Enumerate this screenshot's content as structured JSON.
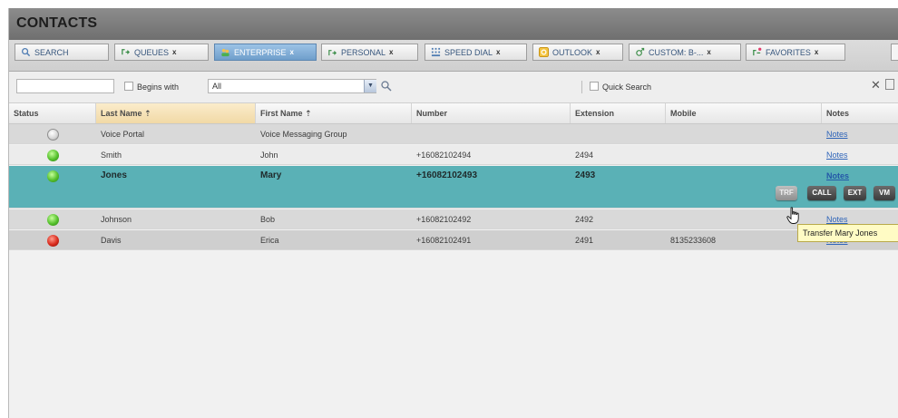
{
  "app": {
    "title": "CONTACTS"
  },
  "tabs": [
    {
      "label": "SEARCH",
      "close": "",
      "icon": "search-icon"
    },
    {
      "label": "QUEUES",
      "close": "x",
      "icon": "queues-icon"
    },
    {
      "label": "ENTERPRISE",
      "close": "x",
      "icon": "enterprise-icon",
      "active": true
    },
    {
      "label": "PERSONAL",
      "close": "x",
      "icon": "personal-icon"
    },
    {
      "label": "SPEED DIAL",
      "close": "x",
      "icon": "speed-dial-icon"
    },
    {
      "label": "OUTLOOK",
      "close": "x",
      "icon": "outlook-icon"
    },
    {
      "label": "CUSTOM: B-...",
      "close": "x",
      "icon": "custom-icon"
    },
    {
      "label": "FAVORITES",
      "close": "x",
      "icon": "favorites-icon"
    }
  ],
  "search": {
    "value": "",
    "begins_with_label": "Begins with",
    "filter_value": "All",
    "quick_search_label": "Quick Search",
    "close_label": "✕"
  },
  "columns": {
    "status": "Status",
    "last_name": "Last Name",
    "first_name": "First Name",
    "number": "Number",
    "extension": "Extension",
    "mobile": "Mobile",
    "notes": "Notes",
    "sort_indicator": "⇡"
  },
  "rows": [
    {
      "status": "gray",
      "last_name": "Voice Portal",
      "first_name": "Voice Messaging Group",
      "number": "",
      "extension": "",
      "mobile": "",
      "notes": "Notes"
    },
    {
      "status": "green",
      "last_name": "Smith",
      "first_name": "John",
      "number": "+16082102494",
      "extension": "2494",
      "mobile": "",
      "notes": "Notes"
    },
    {
      "status": "green",
      "last_name": "Jones",
      "first_name": "Mary",
      "number": "+16082102493",
      "extension": "2493",
      "mobile": "",
      "notes": "Notes",
      "selected": true
    },
    {
      "status": "green",
      "last_name": "Johnson",
      "first_name": "Bob",
      "number": "+16082102492",
      "extension": "2492",
      "mobile": "",
      "notes": "Notes"
    },
    {
      "status": "red",
      "last_name": "Davis",
      "first_name": "Erica",
      "number": "+16082102491",
      "extension": "2491",
      "mobile": "8135233608",
      "notes": "Notes"
    }
  ],
  "row_actions": {
    "transfer": "TRF",
    "call": "CALL",
    "ext": "EXT",
    "vm": "VM"
  },
  "tooltip": "Transfer Mary Jones",
  "colors": {
    "titlebar": "#7c7c7c",
    "active_tab": "#7fa9d3",
    "selected_row": "#5ab1b6",
    "tooltip_bg": "#fffbc4",
    "status_online": "#55c02c",
    "status_busy": "#d92b1d",
    "status_unknown": "#d5d5d5"
  }
}
